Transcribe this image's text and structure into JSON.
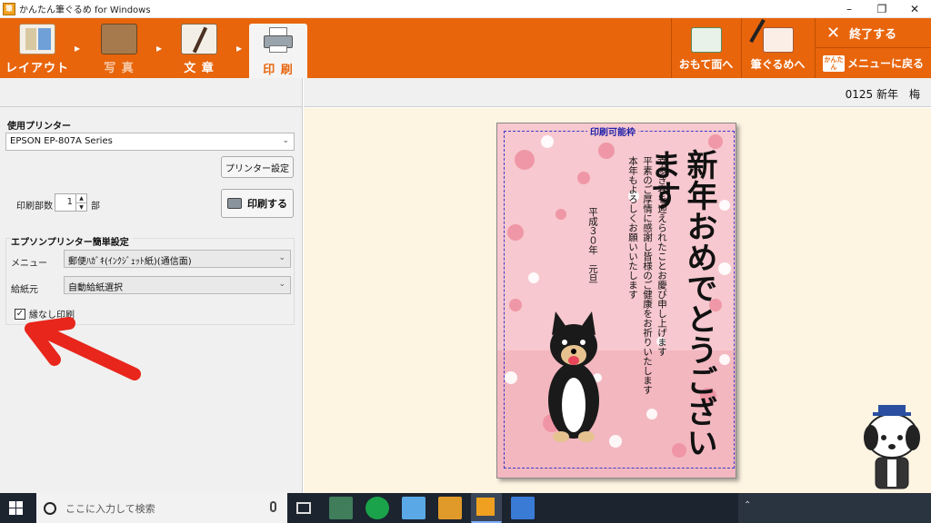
{
  "window": {
    "title": "かんたん筆ぐるめ for Windows",
    "app_icon": "筆"
  },
  "toolbar": {
    "steps": [
      {
        "label": "レイアウト"
      },
      {
        "label": "写 真"
      },
      {
        "label": "文 章"
      },
      {
        "label": "印 刷"
      }
    ],
    "omote_label": "おもて面へ",
    "fudegurume_label": "筆ぐるめへ",
    "end_label": "終了する",
    "menu_label": "メニューに戻る",
    "menu_badge": "かんたん"
  },
  "left_panel": {
    "printer_section_label": "使用プリンター",
    "printer_value": "EPSON EP-807A Series",
    "printer_settings_label": "プリンター設定",
    "copies_label": "印刷部数",
    "copies_value": "1",
    "copies_unit": "部",
    "print_button_label": "印刷する",
    "epson_section_label": "エプソンプリンター簡単設定",
    "menu_label": "メニュー",
    "menu_value": "郵便ﾊｶﾞｷ(ｲﾝｸｼﾞｪｯﾄ紙)(通信面)",
    "feed_label": "給紙元",
    "feed_value": "自動給紙選択",
    "borderless_label": "縁なし印刷",
    "borderless_checked": true
  },
  "right_panel": {
    "doc_name": "0125 新年　梅"
  },
  "preview": {
    "print_area_label": "印刷可能枠",
    "greeting_big": "新年おめでとうございます",
    "message_lines": [
      "幸多き春を迎えられたことお慶び申し上げます",
      "平素のご厚情に感謝し皆様のご健康をお祈りいたします",
      "本年もよろしくお願いいたします"
    ],
    "date_line": "平成３０年　元旦"
  },
  "taskbar": {
    "search_placeholder": "ここに入力して検索"
  },
  "colors": {
    "toolbar": "#e8650c",
    "accent_red": "#e8261c",
    "preview_bg": "#fdf4e2"
  }
}
